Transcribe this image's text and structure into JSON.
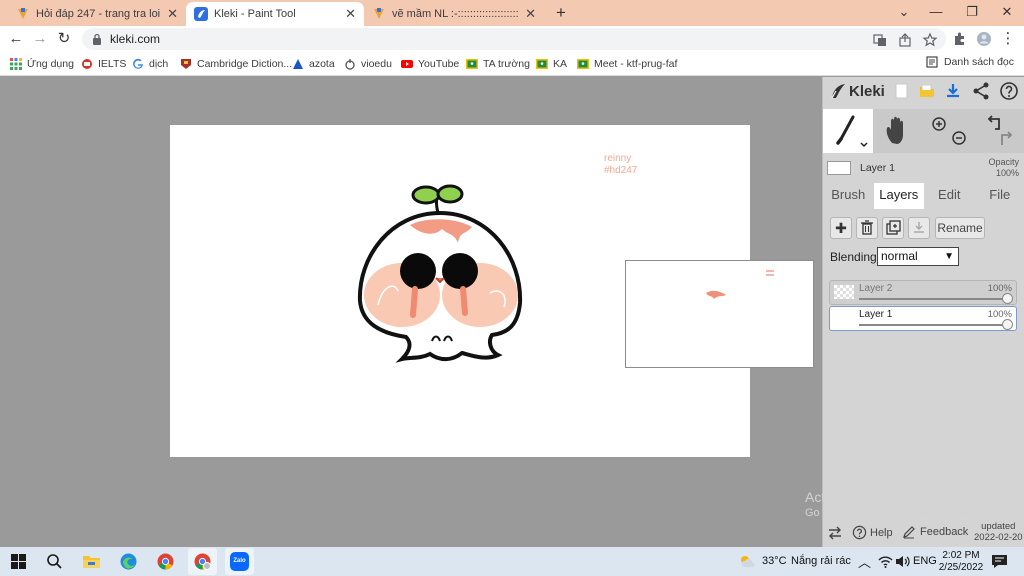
{
  "browser": {
    "tabs": [
      {
        "title": "Hỏi đáp 247 - trang tra loi",
        "favicon": "hoidap-favicon"
      },
      {
        "title": "Kleki - Paint Tool",
        "favicon": "kleki-favicon"
      },
      {
        "title": "vẽ mầm NL :-::::::::::::::::::::::: cl",
        "favicon": "hoidap-favicon"
      }
    ],
    "url": "kleki.com",
    "bookmarks": [
      {
        "label": "Ứng dụng",
        "icon": "apps-grid-icon"
      },
      {
        "label": "IELTS",
        "icon": "ielts-icon"
      },
      {
        "label": "dịch",
        "icon": "google-icon"
      },
      {
        "label": "Cambridge Diction...",
        "icon": "cambridge-icon"
      },
      {
        "label": "azota",
        "icon": "azota-icon"
      },
      {
        "label": "vioedu",
        "icon": "vioedu-icon"
      },
      {
        "label": "YouTube",
        "icon": "youtube-icon"
      },
      {
        "label": "TA trường",
        "icon": "classroom-icon"
      },
      {
        "label": "KA",
        "icon": "classroom-icon"
      },
      {
        "label": "Meet - ktf-prug-faf",
        "icon": "classroom-icon"
      }
    ],
    "reading_list": "Danh sách đọc"
  },
  "kleki": {
    "logo": "Kleki",
    "canvas_text": {
      "line1": "reinny",
      "line2": "#hd247"
    },
    "current_layer": {
      "name": "Layer 1",
      "opacity_label": "Opacity",
      "opacity_value": "100%"
    },
    "panel_tabs": [
      "Brush",
      "Layers",
      "Edit",
      "File"
    ],
    "active_tab": "Layers",
    "rename_label": "Rename",
    "blending_label": "Blending",
    "blending_value": "normal",
    "layers": [
      {
        "name": "Layer 2",
        "opacity": "100%",
        "selected": false
      },
      {
        "name": "Layer 1",
        "opacity": "100%",
        "selected": true
      }
    ],
    "footer": {
      "help": "Help",
      "feedback": "Feedback",
      "updated_label": "updated",
      "updated_date": "2022-02-20"
    }
  },
  "watermark": {
    "line1": "Activate Windows",
    "line2": "Go to Settings to activate Windows."
  },
  "taskbar": {
    "weather_temp": "33°C",
    "weather_text": "Nắng rải rác",
    "language": "ENG",
    "time": "2:02 PM",
    "date": "2/25/2022",
    "zalo_label": "Zalo"
  },
  "colors": {
    "tabstrip": "#f4c9b2",
    "canvas_bg": "#9a9a9a",
    "panel": "#d4d4d4",
    "signature": "#f3a795",
    "taskbar": "#dbe6f1"
  }
}
